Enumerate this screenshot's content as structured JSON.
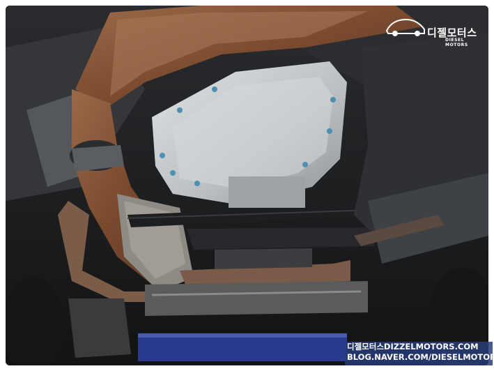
{
  "logo": {
    "brand_korean": "디젤모터스",
    "brand_english": "DIESEL MOTORS"
  },
  "watermark": {
    "line1": "디젤모터스DIZZELMOTORS.COM",
    "line2": "BLOG.NAVER.COM/DIESELMOTORS"
  },
  "palette": {
    "rust": "#8a5a3c",
    "aluminum": "#c9cdd0",
    "frame_black": "#1e1f21",
    "blue_lift": "#2a3a8c"
  }
}
